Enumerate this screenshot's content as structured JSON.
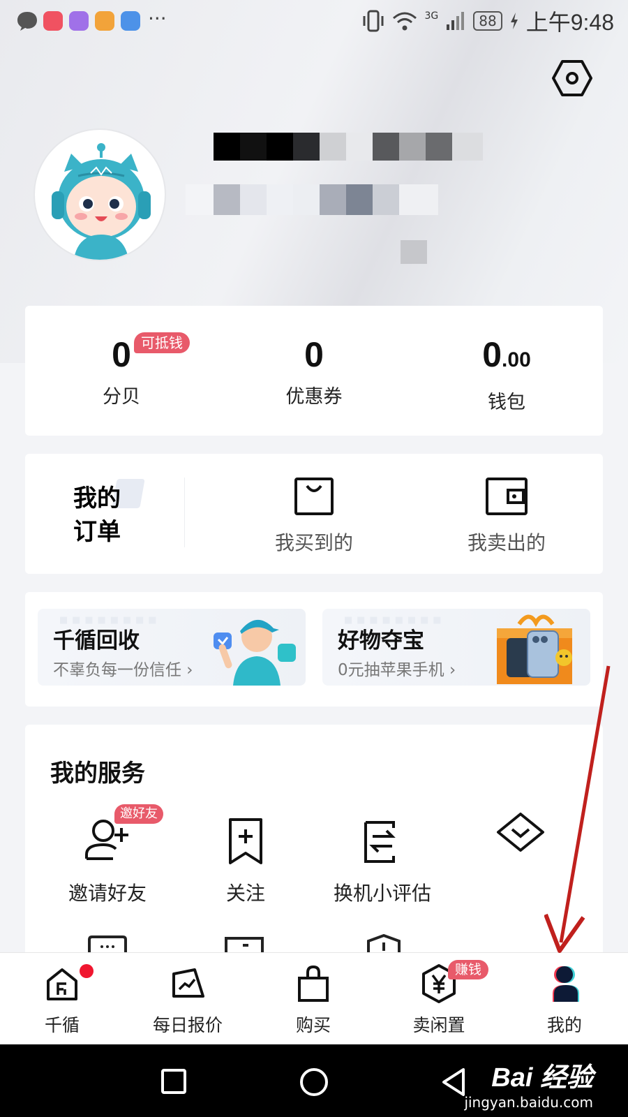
{
  "status_bar": {
    "battery": "88",
    "network": "3G",
    "time": "上午9:48",
    "more": "···"
  },
  "profile": {
    "settings_icon": "hexagon-gear-icon"
  },
  "assets": {
    "fenbei": {
      "value": "0",
      "label": "分贝",
      "badge": "可抵钱"
    },
    "coupon": {
      "value": "0",
      "label": "优惠券"
    },
    "wallet": {
      "value_int": "0",
      "value_dec": ".00",
      "label": "钱包"
    }
  },
  "orders": {
    "title_line1": "我的",
    "title_line2": "订单",
    "bought": "我买到的",
    "sold": "我卖出的"
  },
  "promos": [
    {
      "title": "千循回收",
      "subtitle": "不辜负每一份信任 ›"
    },
    {
      "title": "好物夺宝",
      "subtitle": "0元抽苹果手机 ›"
    }
  ],
  "services": {
    "title": "我的服务",
    "invite_badge": "邀好友",
    "items": [
      {
        "label": "邀请好友"
      },
      {
        "label": "关注"
      },
      {
        "label": "换机小评估"
      },
      {
        "label": ""
      }
    ]
  },
  "tabs": {
    "items": [
      {
        "label": "千循"
      },
      {
        "label": "每日报价"
      },
      {
        "label": "购买"
      },
      {
        "label": "卖闲置"
      },
      {
        "label": "我的"
      }
    ],
    "sell_badge": "赚钱"
  },
  "watermark": {
    "brand": "Bai 经验",
    "url": "jingyan.baidu.com"
  },
  "colors": {
    "badge": "#e85a6a",
    "arrow": "#c0201d",
    "notify_dot": "#f0162f"
  }
}
